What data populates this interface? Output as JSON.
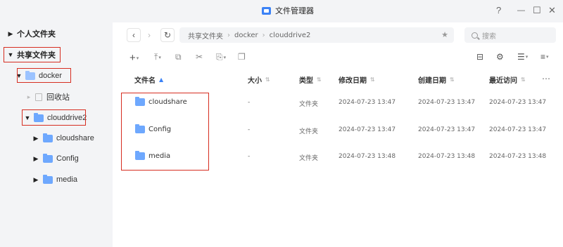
{
  "window": {
    "title": "文件管理器",
    "help_label": "?",
    "minimize_label": "—",
    "maximize_label": "☐",
    "close_label": "✕"
  },
  "sidebar": {
    "personal_folder": "个人文件夹",
    "shared_folder": "共享文件夹",
    "docker": "docker",
    "recycle_bin": "回收站",
    "clouddrive2": "clouddrive2",
    "children": [
      "cloudshare",
      "Config",
      "media"
    ]
  },
  "toolbar": {
    "back": "‹",
    "forward": "›",
    "refresh": "↻",
    "breadcrumb": [
      "共享文件夹",
      "docker",
      "clouddrive2"
    ],
    "favorite": "★",
    "search_placeholder": "搜索"
  },
  "actions": {
    "new": "+",
    "upload": "⤒",
    "copy": "⧉",
    "cut": "✂",
    "share": "⎘",
    "duplicate": "❐",
    "bag": "⊟",
    "settings": "⚙",
    "list_view": "☰",
    "sort": "≡"
  },
  "table": {
    "columns": {
      "name": "文件名",
      "size": "大小",
      "type": "类型",
      "modified": "修改日期",
      "created": "创建日期",
      "accessed": "最近访问",
      "more": "⋯"
    },
    "rows": [
      {
        "name": "cloudshare",
        "size": "-",
        "type": "文件夹",
        "modified": "2024-07-23 13:47",
        "created": "2024-07-23 13:47",
        "accessed": "2024-07-23 13:47"
      },
      {
        "name": "Config",
        "size": "-",
        "type": "文件夹",
        "modified": "2024-07-23 13:47",
        "created": "2024-07-23 13:47",
        "accessed": "2024-07-23 13:47"
      },
      {
        "name": "media",
        "size": "-",
        "type": "文件夹",
        "modified": "2024-07-23 13:48",
        "created": "2024-07-23 13:48",
        "accessed": "2024-07-23 13:48"
      }
    ]
  },
  "colors": {
    "accent": "#3b82f6",
    "highlight_box": "#d62d20",
    "sidebar_bg": "#f3f4f6"
  }
}
